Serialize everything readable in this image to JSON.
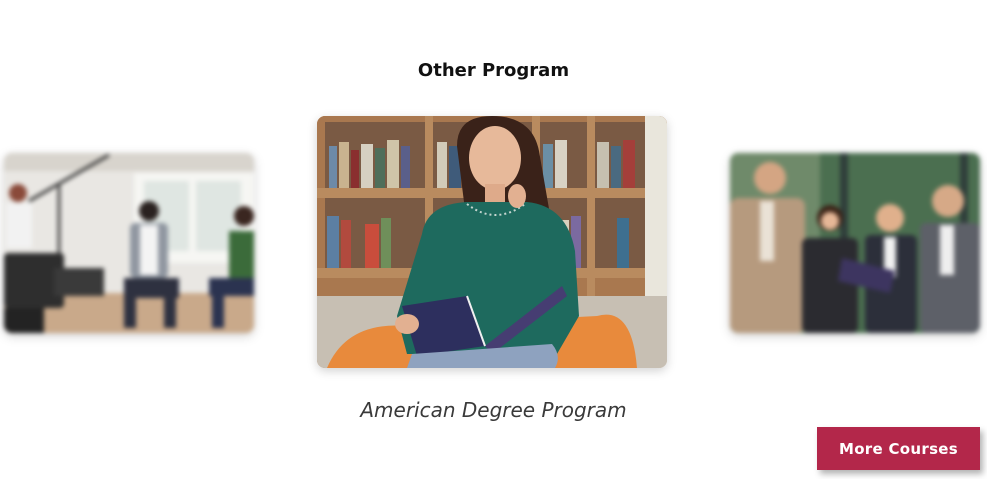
{
  "section": {
    "title": "Other Program"
  },
  "carousel": {
    "slides": [
      {
        "image": "film-studio-photo",
        "position": "previous"
      },
      {
        "image": "student-reading-library-photo",
        "position": "active",
        "caption": "American Degree Program"
      },
      {
        "image": "business-team-photo",
        "position": "next"
      }
    ]
  },
  "actions": {
    "more_courses_label": "More Courses"
  },
  "colors": {
    "accent": "#b3274a"
  }
}
